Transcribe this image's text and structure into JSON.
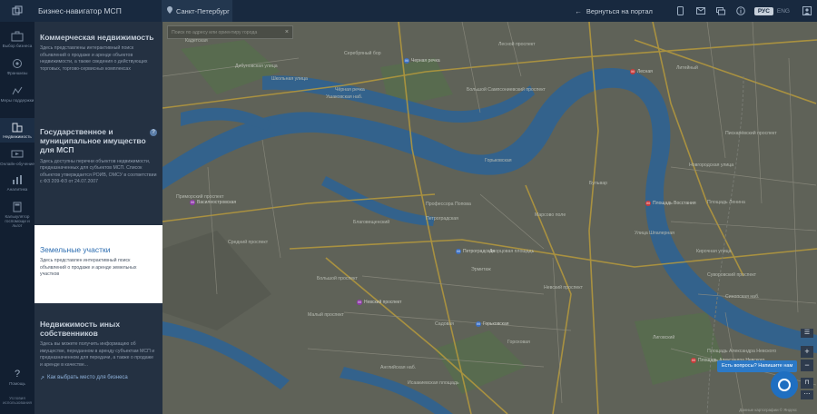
{
  "header": {
    "title": "Бизнес-навигатор МСП",
    "city": "Санкт-Петербург",
    "back_label": "Вернуться на портал",
    "lang_active": "РУС",
    "lang_other": "ENG"
  },
  "rail": {
    "items": [
      {
        "label": "Выбор бизнеса",
        "icon": "briefcase-icon"
      },
      {
        "label": "Франшизы",
        "icon": "franchise-icon"
      },
      {
        "label": "Меры поддержки",
        "icon": "support-icon"
      },
      {
        "label": "Недвижимость",
        "icon": "building-icon",
        "active": true
      },
      {
        "label": "Онлайн-обучение",
        "icon": "education-icon"
      },
      {
        "label": "Аналитика",
        "icon": "chart-icon"
      },
      {
        "label": "Калькулятор госпомощи и льгот",
        "icon": "calculator-icon"
      }
    ],
    "help_label": "Помощь",
    "terms_label": "Условия использования"
  },
  "panel": {
    "sections": [
      {
        "title": "Коммерческая недвижимость",
        "text": "Здесь представлены интерактивный поиск объявлений о продаже и аренде объектов недвижимости, а также сведения о действующих торговых, торгово-сервисных комплексах"
      },
      {
        "title": "Государственное и муниципальное имущество для МСП",
        "text": "Здесь доступны перечни объектов недвижимости, предназначенных для субъектов МСП. Список объектов утверждается РОИВ, ОМСУ в соответствии с ФЗ 209-ФЗ от 24.07.2007"
      },
      {
        "title": "Земельные участки",
        "text": "Здесь представлен интерактивный поиск объявлений о продаже и аренде земельных участков"
      },
      {
        "title": "Недвижимость иных собственников",
        "text": "Здесь вы можете получить информацию об имуществе, переданном в аренду субъектам МСП и предназначенном для передачи, а также о продаже и аренде в качестве...",
        "link": "Как выбрать место для бизнеса"
      }
    ]
  },
  "map": {
    "search_placeholder": "Поиск по адресу или ориентиру города",
    "labels": [
      "Кадетская",
      "Дибуновская улица",
      "Серебряный бор",
      "Чёрная речка",
      "Школьная улица",
      "Ушаковская наб.",
      "Лесной проспект",
      "Большой Сампсониевский проспект",
      "Литейный",
      "Новгородская улица",
      "Приморский проспект",
      "Петроградская",
      "Невский проспект",
      "Средний проспект",
      "Профессора Попова",
      "Площадь Ленина",
      "Горьковская",
      "Кирочная улица",
      "Суворовский проспект",
      "Улица Шпалерная",
      "Большой проспект",
      "Малый проспект",
      "Садовая",
      "Гороховая",
      "Благовещенский",
      "Английская наб.",
      "Лиговский",
      "Площадь Александра Невского",
      "Пискарёвский проспект",
      "Синопская наб.",
      "Бульвар",
      "Эрмитаж",
      "Дворцовая площадь",
      "Марсово поле",
      "Исаакиевская площадь"
    ],
    "stations": [
      "Черная речка",
      "Лесная",
      "Петроградская",
      "Горьковская",
      "Василеостровская",
      "Невский проспект",
      "Площадь Восстания",
      "Площадь Александра Невского"
    ],
    "zoom_in": "+",
    "zoom_out": "−",
    "chat_prompt": "Есть вопросы? Напишите нам",
    "attribution": "Данные картографии © Яндекс"
  },
  "colors": {
    "accent": "#2c79c6",
    "topbar": "#18293f",
    "panel": "#243142",
    "water": "#33628c",
    "land": "#5d6056"
  }
}
